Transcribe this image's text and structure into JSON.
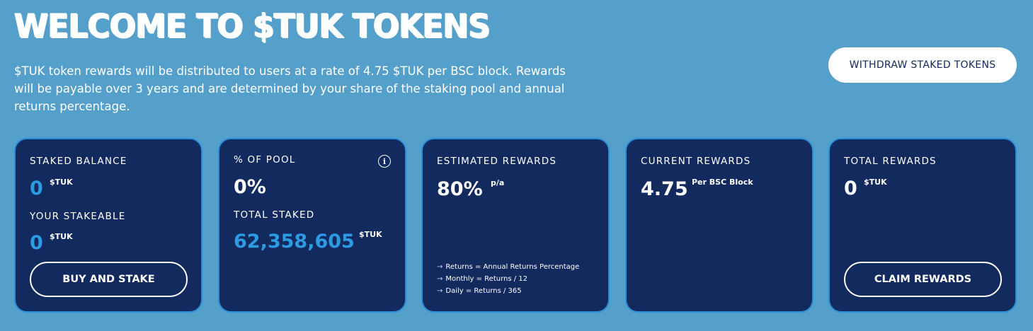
{
  "header": {
    "title": "WELCOME TO $TUK TOKENS",
    "intro": "$TUK token rewards will be distributed to users at a rate of 4.75 $TUK per BSC block. Rewards will be payable over 3 years and are determined by your share of the staking pool and annual returns percentage.",
    "withdraw_label": "WITHDRAW STAKED TOKENS"
  },
  "cards": {
    "staked": {
      "label": "STAKED BALANCE",
      "value": "0",
      "unit": "$TUK",
      "stakeable_label": "YOUR STAKEABLE",
      "stakeable_value": "0",
      "stakeable_unit": "$TUK",
      "button_label": "BUY AND STAKE"
    },
    "pool": {
      "label": "% OF POOL",
      "value": "0%",
      "info_icon": "info-icon",
      "total_label": "TOTAL STAKED",
      "total_value": "62,358,605",
      "total_unit": "$TUK"
    },
    "estimated": {
      "label": "ESTIMATED REWARDS",
      "value": "80%",
      "unit": "p/a",
      "notes": [
        "Returns = Annual Returns Percentage",
        "Monthly = Returns / 12",
        "Daily = Returns / 365"
      ]
    },
    "current": {
      "label": "CURRENT REWARDS",
      "value": "4.75",
      "unit": "Per BSC Block"
    },
    "total": {
      "label": "TOTAL REWARDS",
      "value": "0",
      "unit": "$TUK",
      "button_label": "CLAIM REWARDS"
    }
  },
  "colors": {
    "background": "#559fcb",
    "card": "#122a5e",
    "card_border": "#2a8fd9",
    "accent_blue": "#2d9be4"
  }
}
